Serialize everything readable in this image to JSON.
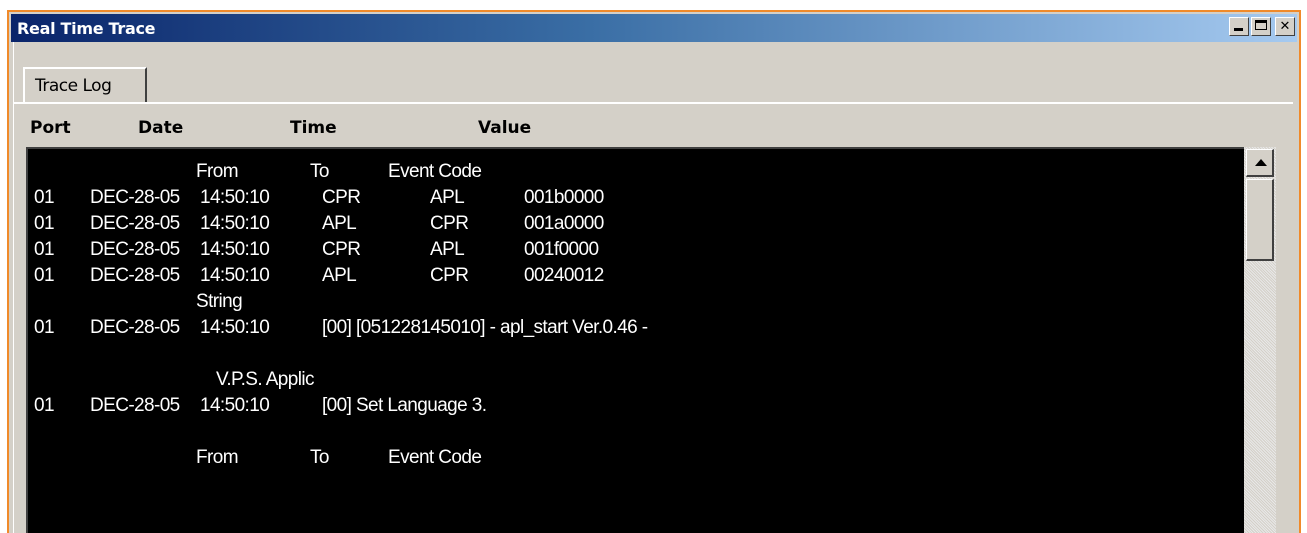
{
  "window": {
    "title": "Real Time Trace"
  },
  "tabs": [
    {
      "label": "Trace Log",
      "active": true
    }
  ],
  "columns": {
    "port": "Port",
    "date": "Date",
    "time": "Time",
    "value": "Value"
  },
  "log": [
    {
      "port": "",
      "date": "",
      "time": "",
      "c1": "From",
      "c2": "To",
      "c3": "Event Code",
      "kind": "header"
    },
    {
      "port": "01",
      "date": "DEC-28-05",
      "time": "14:50:10",
      "c1": "CPR",
      "c2": "APL",
      "c3": "001b0000",
      "kind": "event"
    },
    {
      "port": "01",
      "date": "DEC-28-05",
      "time": "14:50:10",
      "c1": "APL",
      "c2": "CPR",
      "c3": "001a0000",
      "kind": "event"
    },
    {
      "port": "01",
      "date": "DEC-28-05",
      "time": "14:50:10",
      "c1": "CPR",
      "c2": "APL",
      "c3": "001f0000",
      "kind": "event"
    },
    {
      "port": "01",
      "date": "DEC-28-05",
      "time": "14:50:10",
      "c1": "APL",
      "c2": "CPR",
      "c3": "00240012",
      "kind": "event"
    },
    {
      "text": "String",
      "kind": "label"
    },
    {
      "port": "01",
      "date": "DEC-28-05",
      "time": "14:50:10",
      "text": "[00] [051228145010] - apl_start Ver.0.46 -",
      "kind": "message"
    },
    {
      "text": "",
      "kind": "blank"
    },
    {
      "text": "V.P.S. Applic",
      "kind": "label2"
    },
    {
      "port": "01",
      "date": "DEC-28-05",
      "time": "14:50:10",
      "text": "[00] Set Language 3.",
      "kind": "message"
    },
    {
      "text": "",
      "kind": "blank"
    },
    {
      "port": "",
      "date": "",
      "time": "",
      "c1": "From",
      "c2": "To",
      "c3": "Event Code",
      "kind": "header"
    }
  ]
}
